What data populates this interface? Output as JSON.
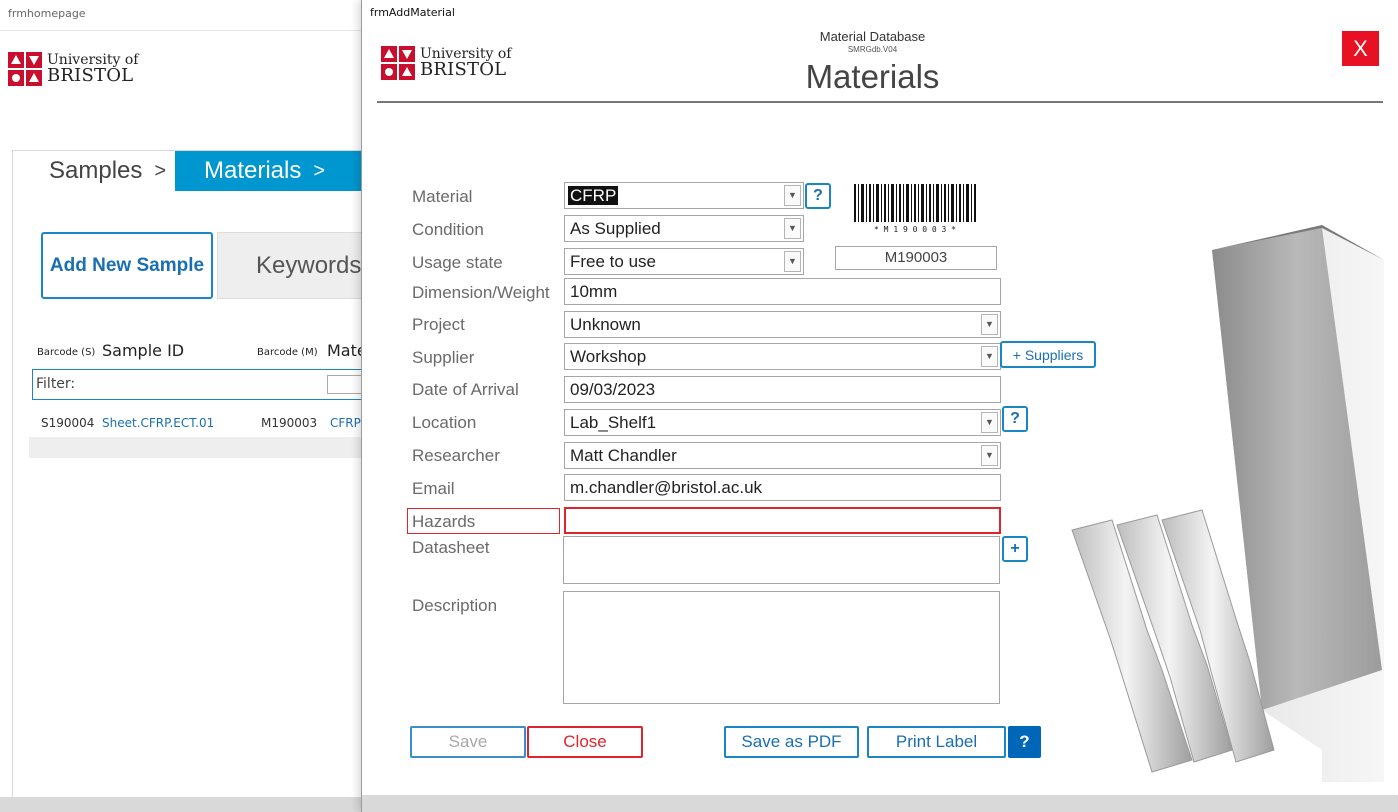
{
  "home": {
    "window_title": "frmhomepage",
    "logo": {
      "line1": "University of",
      "line2": "BRISTOL"
    },
    "tabs": [
      {
        "label": "Samples",
        "arrow": ">"
      },
      {
        "label": "Materials",
        "arrow": ">"
      }
    ],
    "add_sample_label": "Add New Sample",
    "keywords_label": "Keywords:",
    "columns": {
      "barcode_s": "Barcode (S)",
      "sample_id": "Sample ID",
      "barcode_m": "Barcode (M)",
      "material": "Mate"
    },
    "filter_label": "Filter:",
    "rows": [
      {
        "barcode_s": "S190004",
        "sample_id": "Sheet.CFRP.ECT.01",
        "barcode_m": "M190003",
        "material": "CFRP"
      }
    ]
  },
  "dialog": {
    "window_title": "frmAddMaterial",
    "logo": {
      "line1": "University of",
      "line2": "BRISTOL"
    },
    "db_title": "Material Database",
    "db_version": "SMRGdb.V04",
    "form_title": "Materials",
    "close_x": "X",
    "labels": {
      "material": "Material",
      "condition": "Condition",
      "usage_state": "Usage state",
      "dimension": "Dimension/Weight",
      "project": "Project",
      "supplier": "Supplier",
      "date_of_arrival": "Date of Arrival",
      "location": "Location",
      "researcher": "Researcher",
      "email": "Email",
      "hazards": "Hazards",
      "datasheet": "Datasheet",
      "description": "Description"
    },
    "values": {
      "material": "CFRP",
      "condition": "As Supplied",
      "usage_state": "Free to use",
      "dimension": "10mm",
      "project": "Unknown",
      "supplier": "Workshop",
      "date_of_arrival": "09/03/2023",
      "location": "Lab_Shelf1",
      "researcher": "Matt Chandler",
      "email": "m.chandler@bristol.ac.uk",
      "hazards": "",
      "datasheet": "",
      "description": ""
    },
    "barcode_text": "* M 1 9 0 0 0 3 *",
    "barcode_value": "M190003",
    "help_glyph": "?",
    "add_glyph": "+",
    "suppliers_button": "+ Suppliers",
    "buttons": {
      "save": "Save",
      "close": "Close",
      "save_pdf": "Save as PDF",
      "print_label": "Print Label",
      "help": "?"
    },
    "colors": {
      "accent": "#0096cf",
      "danger": "#e81123",
      "help_bg": "#0067b8"
    }
  }
}
